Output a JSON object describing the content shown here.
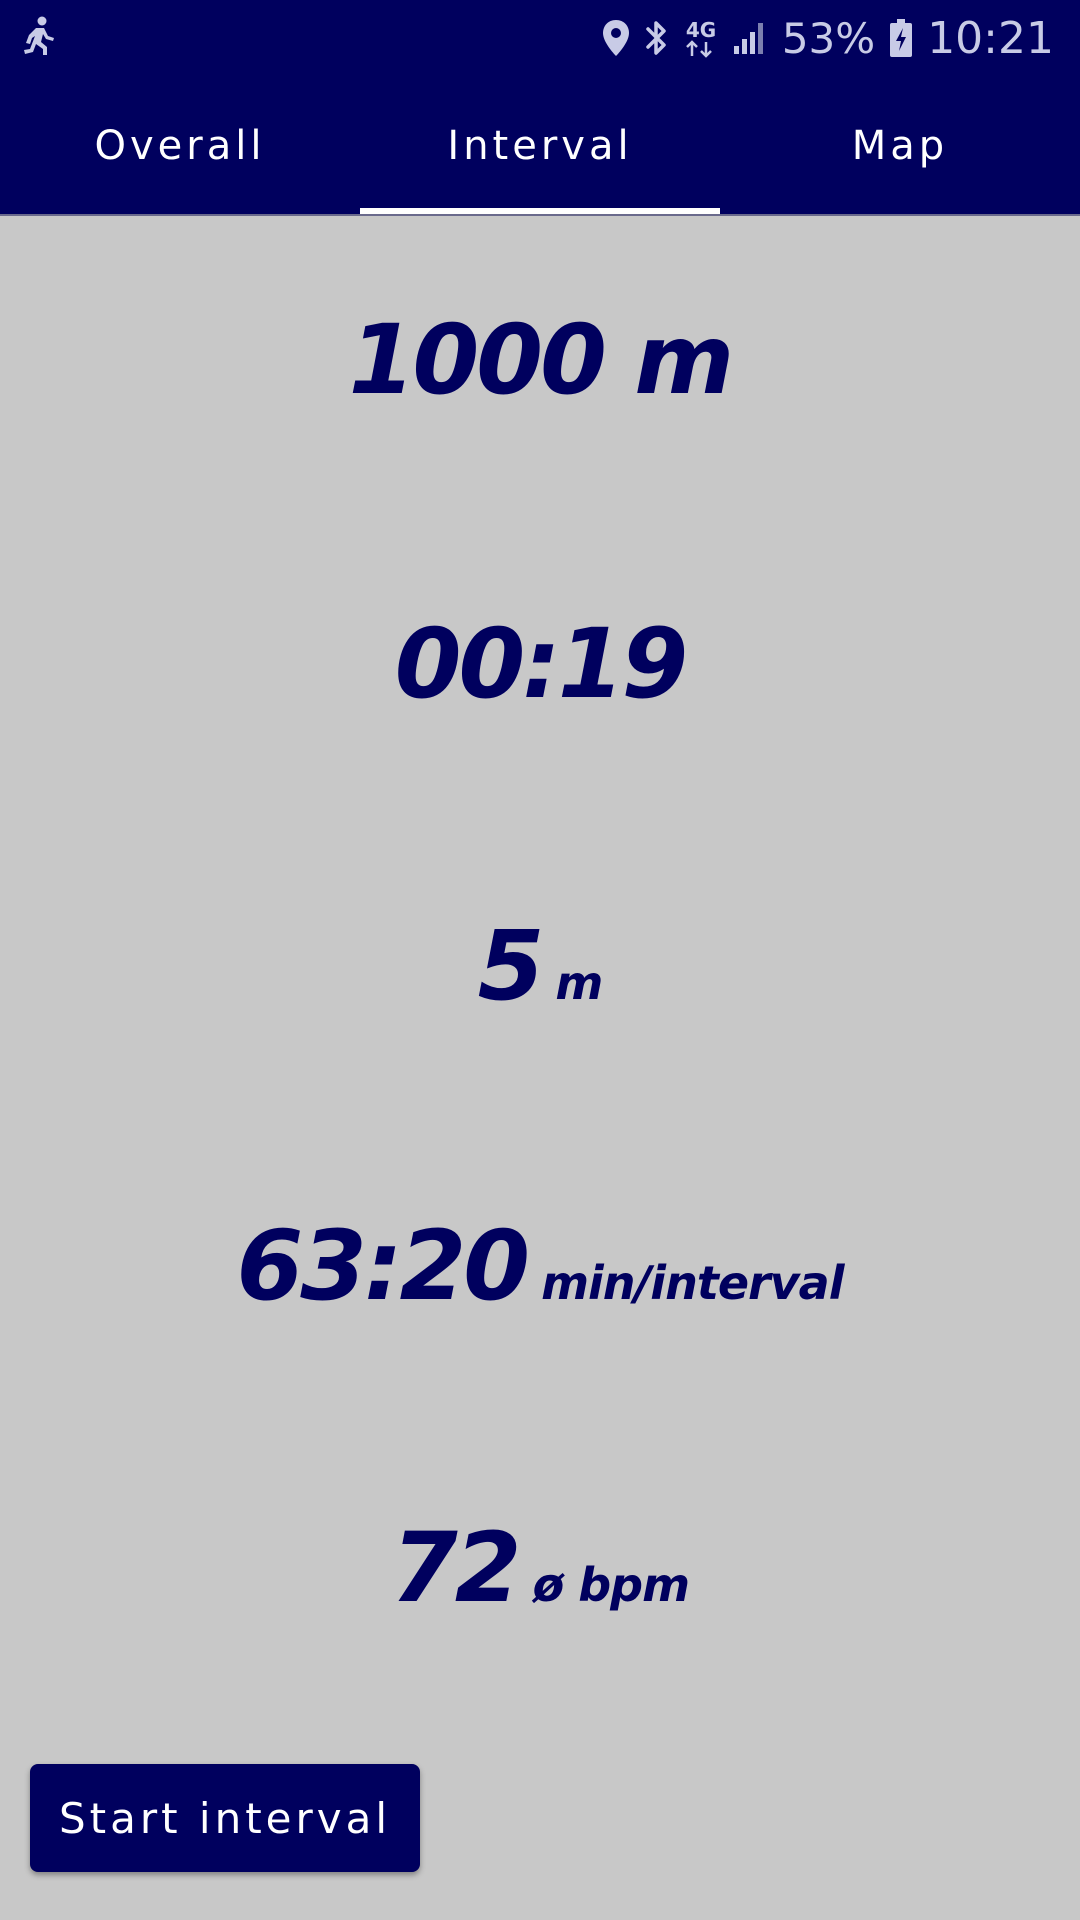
{
  "status_bar": {
    "app_icon": "running-person-icon",
    "icons": [
      "location-pin-icon",
      "bluetooth-icon",
      "network-4g-icon",
      "signal-strength-icon"
    ],
    "network_label": "4G",
    "battery_percent": "53%",
    "battery_icon": "battery-charging-icon",
    "time": "10:21"
  },
  "tabs": [
    {
      "label": "Overall",
      "active": false
    },
    {
      "label": "Interval",
      "active": true
    },
    {
      "label": "Map",
      "active": false
    }
  ],
  "metrics": {
    "distance": {
      "value": "1000 m",
      "unit": ""
    },
    "time": {
      "value": "00:19",
      "unit": ""
    },
    "covered": {
      "value": "5",
      "unit": "m"
    },
    "pace": {
      "value": "63:20",
      "unit": "min/interval"
    },
    "heart_rate": {
      "value": "72",
      "unit": "ø bpm"
    }
  },
  "actions": {
    "start_label": "Start interval"
  },
  "colors": {
    "primary": "#00005e",
    "background": "#c8c8c8",
    "on_primary": "#ffffff"
  }
}
